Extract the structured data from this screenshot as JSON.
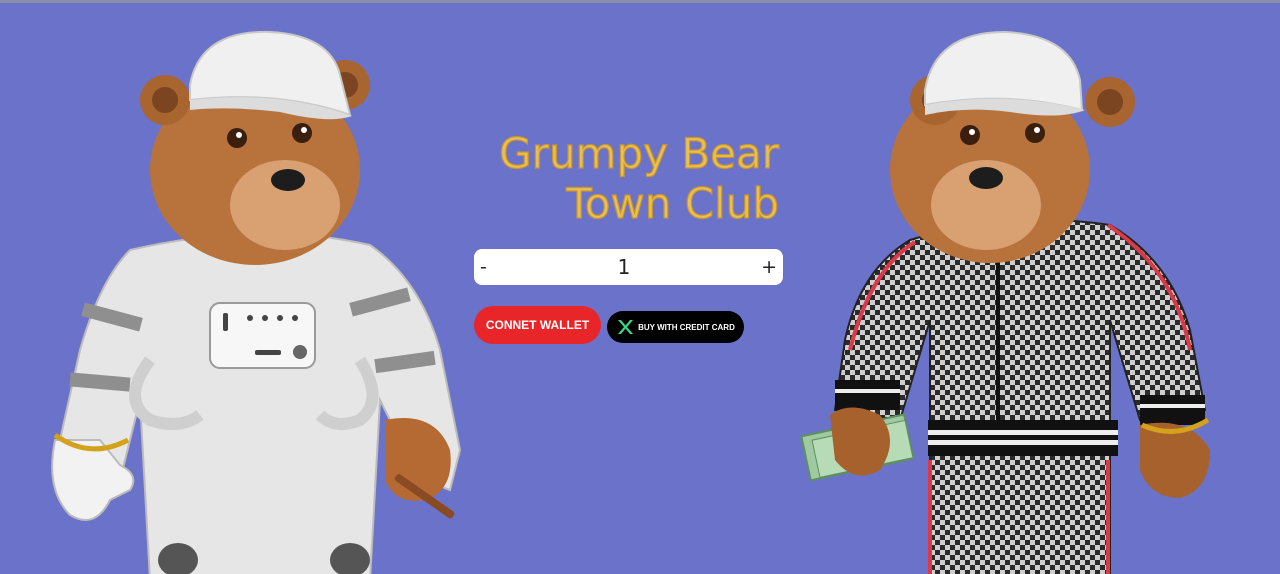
{
  "logo": {
    "line1": "Grumpy Bear",
    "line2": "Town Club"
  },
  "quantity": {
    "minus": "-",
    "value": "1",
    "plus": "+"
  },
  "buttons": {
    "connect_wallet": "CONNET WALLET",
    "buy_credit_card": "BUY WITH CREDIT CARD"
  },
  "colors": {
    "background": "#6b72c9",
    "logo_gold": "#e9bf52",
    "connect_red": "#e8262a",
    "card_black": "#000000",
    "card_icon_green": "#39d98a"
  },
  "icons": {
    "credit_card": "x-logo-icon"
  },
  "images": {
    "left_bear": "bear in white astronaut suit holding cigar",
    "right_bear": "bear in checkered tracksuit holding cash"
  }
}
